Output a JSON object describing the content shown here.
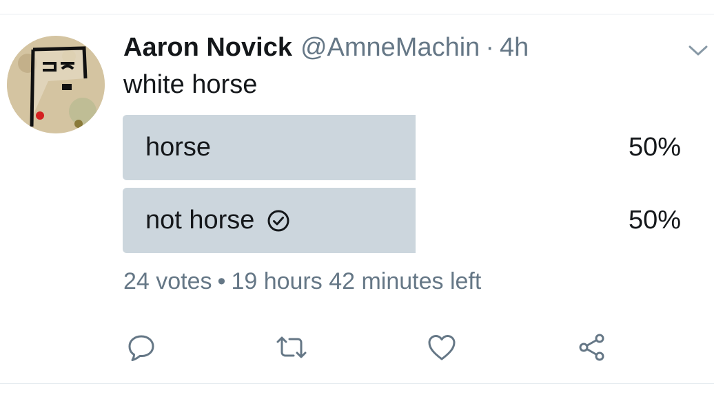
{
  "tweet": {
    "author_name": "Aaron Novick",
    "handle": "@AmneMachin",
    "separator": "·",
    "time": "4h",
    "text": "white horse"
  },
  "poll": {
    "options": [
      {
        "label": "horse",
        "percent": "50%",
        "fraction": 0.5,
        "chosen": false
      },
      {
        "label": "not horse",
        "percent": "50%",
        "fraction": 0.5,
        "chosen": true
      }
    ],
    "votes": "24 votes",
    "meta_separator": "•",
    "time_left": "19 hours 42 minutes left"
  },
  "icons": {
    "menu": "chevron-down-icon",
    "chosen": "check-circle-icon",
    "reply": "reply-icon",
    "retweet": "retweet-icon",
    "like": "heart-icon",
    "share": "share-icon"
  },
  "colors": {
    "text": "#14171a",
    "secondary": "#657786",
    "poll_fill": "#ccd6dd",
    "divider": "#e6ecf0"
  }
}
